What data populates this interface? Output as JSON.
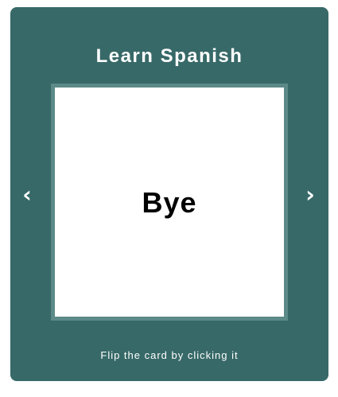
{
  "app": {
    "title": "Learn Spanish"
  },
  "card": {
    "word": "Bye"
  },
  "nav": {
    "prev_glyph": "‹",
    "next_glyph": "›",
    "prev_icon": "chevron-left-icon",
    "next_icon": "chevron-right-icon"
  },
  "hint": "Flip the card by clicking it",
  "colors": {
    "panel_background": "#376968",
    "card_border": "#5b8a88",
    "card_background": "#ffffff",
    "text_light": "#ffffff",
    "text_dark": "#000000"
  }
}
